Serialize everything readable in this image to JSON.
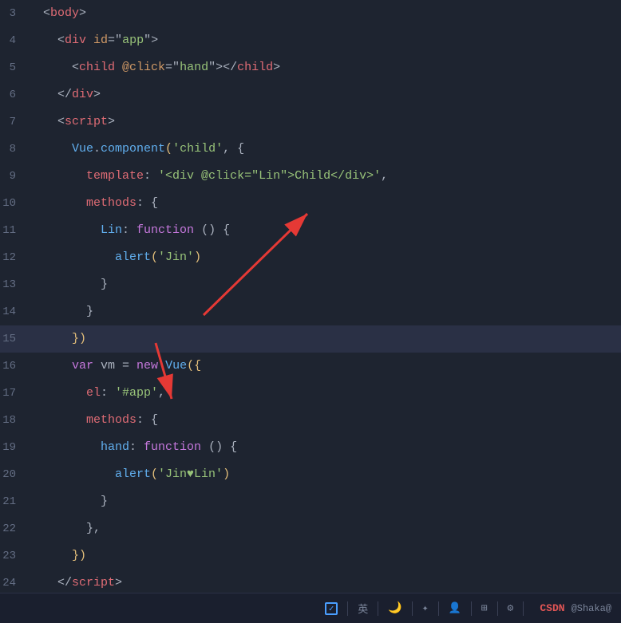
{
  "editor": {
    "background": "#1e2430",
    "lines": [
      {
        "num": "3",
        "tokens": [
          {
            "text": "  <",
            "cls": "punctuation"
          },
          {
            "text": "body",
            "cls": "tag"
          },
          {
            "text": ">",
            "cls": "punctuation"
          }
        ]
      },
      {
        "num": "4",
        "tokens": [
          {
            "text": "    <",
            "cls": "punctuation"
          },
          {
            "text": "div ",
            "cls": "tag"
          },
          {
            "text": "id",
            "cls": "attr-name"
          },
          {
            "text": "=\"",
            "cls": "punctuation"
          },
          {
            "text": "app",
            "cls": "string"
          },
          {
            "text": "\">",
            "cls": "punctuation"
          }
        ]
      },
      {
        "num": "5",
        "tokens": [
          {
            "text": "      <",
            "cls": "punctuation"
          },
          {
            "text": "child ",
            "cls": "tag"
          },
          {
            "text": "@click",
            "cls": "attr-name"
          },
          {
            "text": "=\"",
            "cls": "punctuation"
          },
          {
            "text": "hand",
            "cls": "string"
          },
          {
            "text": "\"></",
            "cls": "punctuation"
          },
          {
            "text": "child",
            "cls": "tag"
          },
          {
            "text": ">",
            "cls": "punctuation"
          }
        ]
      },
      {
        "num": "6",
        "tokens": [
          {
            "text": "    </",
            "cls": "punctuation"
          },
          {
            "text": "div",
            "cls": "tag"
          },
          {
            "text": ">",
            "cls": "punctuation"
          }
        ]
      },
      {
        "num": "7",
        "tokens": [
          {
            "text": "    <",
            "cls": "punctuation"
          },
          {
            "text": "script",
            "cls": "tag"
          },
          {
            "text": ">",
            "cls": "punctuation"
          }
        ]
      },
      {
        "num": "8",
        "tokens": [
          {
            "text": "      Vue",
            "cls": "vue-component"
          },
          {
            "text": ".",
            "cls": "punctuation"
          },
          {
            "text": "component",
            "cls": "method"
          },
          {
            "text": "(",
            "cls": "bracket"
          },
          {
            "text": "'child'",
            "cls": "string"
          },
          {
            "text": ", {",
            "cls": "punctuation"
          }
        ]
      },
      {
        "num": "9",
        "tokens": [
          {
            "text": "        template",
            "cls": "property"
          },
          {
            "text": ": ",
            "cls": "punctuation"
          },
          {
            "text": "'<div @click=\"Lin\">Child</div>'",
            "cls": "string"
          },
          {
            "text": ",",
            "cls": "punctuation"
          }
        ]
      },
      {
        "num": "10",
        "tokens": [
          {
            "text": "        methods",
            "cls": "property"
          },
          {
            "text": ": {",
            "cls": "punctuation"
          }
        ]
      },
      {
        "num": "11",
        "tokens": [
          {
            "text": "          Lin",
            "cls": "method"
          },
          {
            "text": ": ",
            "cls": "punctuation"
          },
          {
            "text": "function",
            "cls": "func-keyword"
          },
          {
            "text": " () {",
            "cls": "punctuation"
          }
        ]
      },
      {
        "num": "12",
        "tokens": [
          {
            "text": "            alert",
            "cls": "alert-fn"
          },
          {
            "text": "(",
            "cls": "bracket"
          },
          {
            "text": "'Jin'",
            "cls": "string"
          },
          {
            "text": ")",
            "cls": "bracket"
          }
        ]
      },
      {
        "num": "13",
        "tokens": [
          {
            "text": "          }",
            "cls": "punctuation"
          }
        ]
      },
      {
        "num": "14",
        "tokens": [
          {
            "text": "        }",
            "cls": "punctuation"
          }
        ]
      },
      {
        "num": "15",
        "highlight": true,
        "tokens": [
          {
            "text": "      })",
            "cls": "bracket"
          }
        ]
      },
      {
        "num": "16",
        "tokens": [
          {
            "text": "      ",
            "cls": "punctuation"
          },
          {
            "text": "var",
            "cls": "var-keyword"
          },
          {
            "text": " vm = ",
            "cls": "punctuation"
          },
          {
            "text": "new",
            "cls": "keyword"
          },
          {
            "text": " Vue",
            "cls": "vue-component"
          },
          {
            "text": "({",
            "cls": "bracket"
          }
        ]
      },
      {
        "num": "17",
        "tokens": [
          {
            "text": "        el",
            "cls": "property"
          },
          {
            "text": ": ",
            "cls": "punctuation"
          },
          {
            "text": "'#app'",
            "cls": "string"
          },
          {
            "text": ",",
            "cls": "punctuation"
          }
        ]
      },
      {
        "num": "18",
        "tokens": [
          {
            "text": "        methods",
            "cls": "property"
          },
          {
            "text": ": {",
            "cls": "punctuation"
          }
        ]
      },
      {
        "num": "19",
        "tokens": [
          {
            "text": "          hand",
            "cls": "method"
          },
          {
            "text": ": ",
            "cls": "punctuation"
          },
          {
            "text": "function",
            "cls": "func-keyword"
          },
          {
            "text": " () {",
            "cls": "punctuation"
          }
        ]
      },
      {
        "num": "20",
        "tokens": [
          {
            "text": "            alert",
            "cls": "alert-fn"
          },
          {
            "text": "(",
            "cls": "bracket"
          },
          {
            "text": "'Jin♥Lin'",
            "cls": "string"
          },
          {
            "text": ")",
            "cls": "bracket"
          }
        ]
      },
      {
        "num": "21",
        "tokens": [
          {
            "text": "          }",
            "cls": "punctuation"
          }
        ]
      },
      {
        "num": "22",
        "tokens": [
          {
            "text": "        },",
            "cls": "punctuation"
          }
        ]
      },
      {
        "num": "23",
        "tokens": [
          {
            "text": "      })",
            "cls": "bracket"
          }
        ]
      },
      {
        "num": "24",
        "tokens": [
          {
            "text": "    </",
            "cls": "punctuation"
          },
          {
            "text": "script",
            "cls": "tag"
          },
          {
            "text": ">",
            "cls": "punctuation"
          }
        ]
      }
    ]
  },
  "toolbar": {
    "items": [
      {
        "label": "英",
        "name": "language-toggle"
      },
      {
        "label": "🌙",
        "name": "theme-moon"
      },
      {
        "label": "✦",
        "name": "star-icon"
      },
      {
        "label": "👤",
        "name": "user-icon"
      },
      {
        "label": "⊞",
        "name": "grid-icon"
      },
      {
        "label": "⚙",
        "name": "settings-icon"
      }
    ],
    "csdn_label": "CSDN",
    "author_label": "@Shaka@"
  }
}
